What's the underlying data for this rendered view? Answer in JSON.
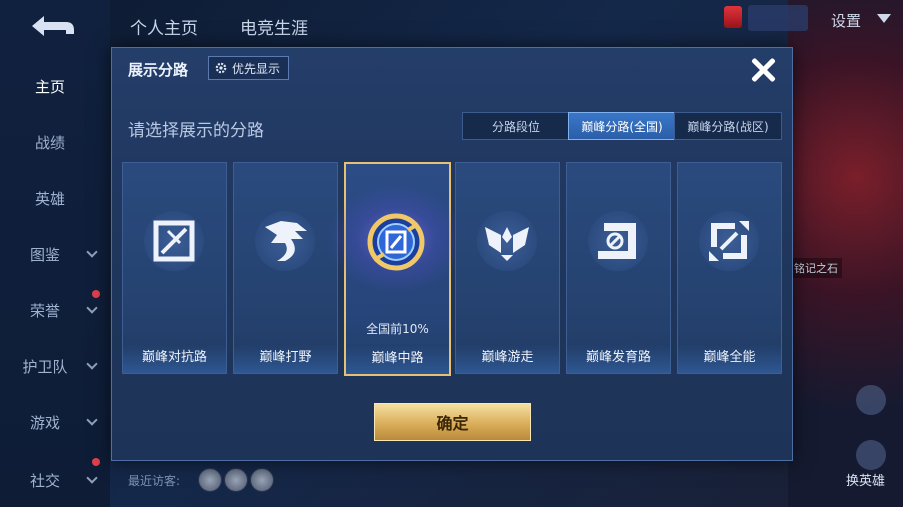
{
  "header": {
    "tabs": [
      "个人主页",
      "电竞生涯"
    ],
    "settings_label": "设置"
  },
  "sidebar": {
    "items": [
      {
        "label": "主页",
        "active": true,
        "chevron": false,
        "dot": false
      },
      {
        "label": "战绩",
        "active": false,
        "chevron": false,
        "dot": false
      },
      {
        "label": "英雄",
        "active": false,
        "chevron": false,
        "dot": false
      },
      {
        "label": "图鉴",
        "active": false,
        "chevron": true,
        "dot": false
      },
      {
        "label": "荣誉",
        "active": false,
        "chevron": true,
        "dot": true
      },
      {
        "label": "护卫队",
        "active": false,
        "chevron": true,
        "dot": false
      },
      {
        "label": "游戏",
        "active": false,
        "chevron": true,
        "dot": false
      },
      {
        "label": "社交",
        "active": false,
        "chevron": true,
        "dot": true
      }
    ]
  },
  "footer": {
    "visitors_label": "最近访客:",
    "swap_hero_label": "换英雄"
  },
  "background": {
    "stone_label": "铭记之石"
  },
  "dialog": {
    "title": "展示分路",
    "priority_label": "优先显示",
    "prompt": "请选择展示的分路",
    "segments": [
      {
        "label": "分路段位",
        "active": false
      },
      {
        "label": "巅峰分路(全国)",
        "active": true
      },
      {
        "label": "巅峰分路(战区)",
        "active": false
      }
    ],
    "cards": [
      {
        "label": "巅峰对抗路",
        "icon": "clash-lane-icon",
        "selected": false,
        "rank": ""
      },
      {
        "label": "巅峰打野",
        "icon": "jungle-dragon-icon",
        "selected": false,
        "rank": ""
      },
      {
        "label": "巅峰中路",
        "icon": "mid-lane-badge-icon",
        "selected": true,
        "rank": "全国前10%"
      },
      {
        "label": "巅峰游走",
        "icon": "roam-wings-icon",
        "selected": false,
        "rank": ""
      },
      {
        "label": "巅峰发育路",
        "icon": "farm-lane-icon",
        "selected": false,
        "rank": ""
      },
      {
        "label": "巅峰全能",
        "icon": "all-round-icon",
        "selected": false,
        "rank": ""
      }
    ],
    "confirm_label": "确定"
  },
  "colors": {
    "accent_gold": "#e6c073",
    "active_segment": "#3a77c8",
    "dialog_bg": "#20375e"
  }
}
